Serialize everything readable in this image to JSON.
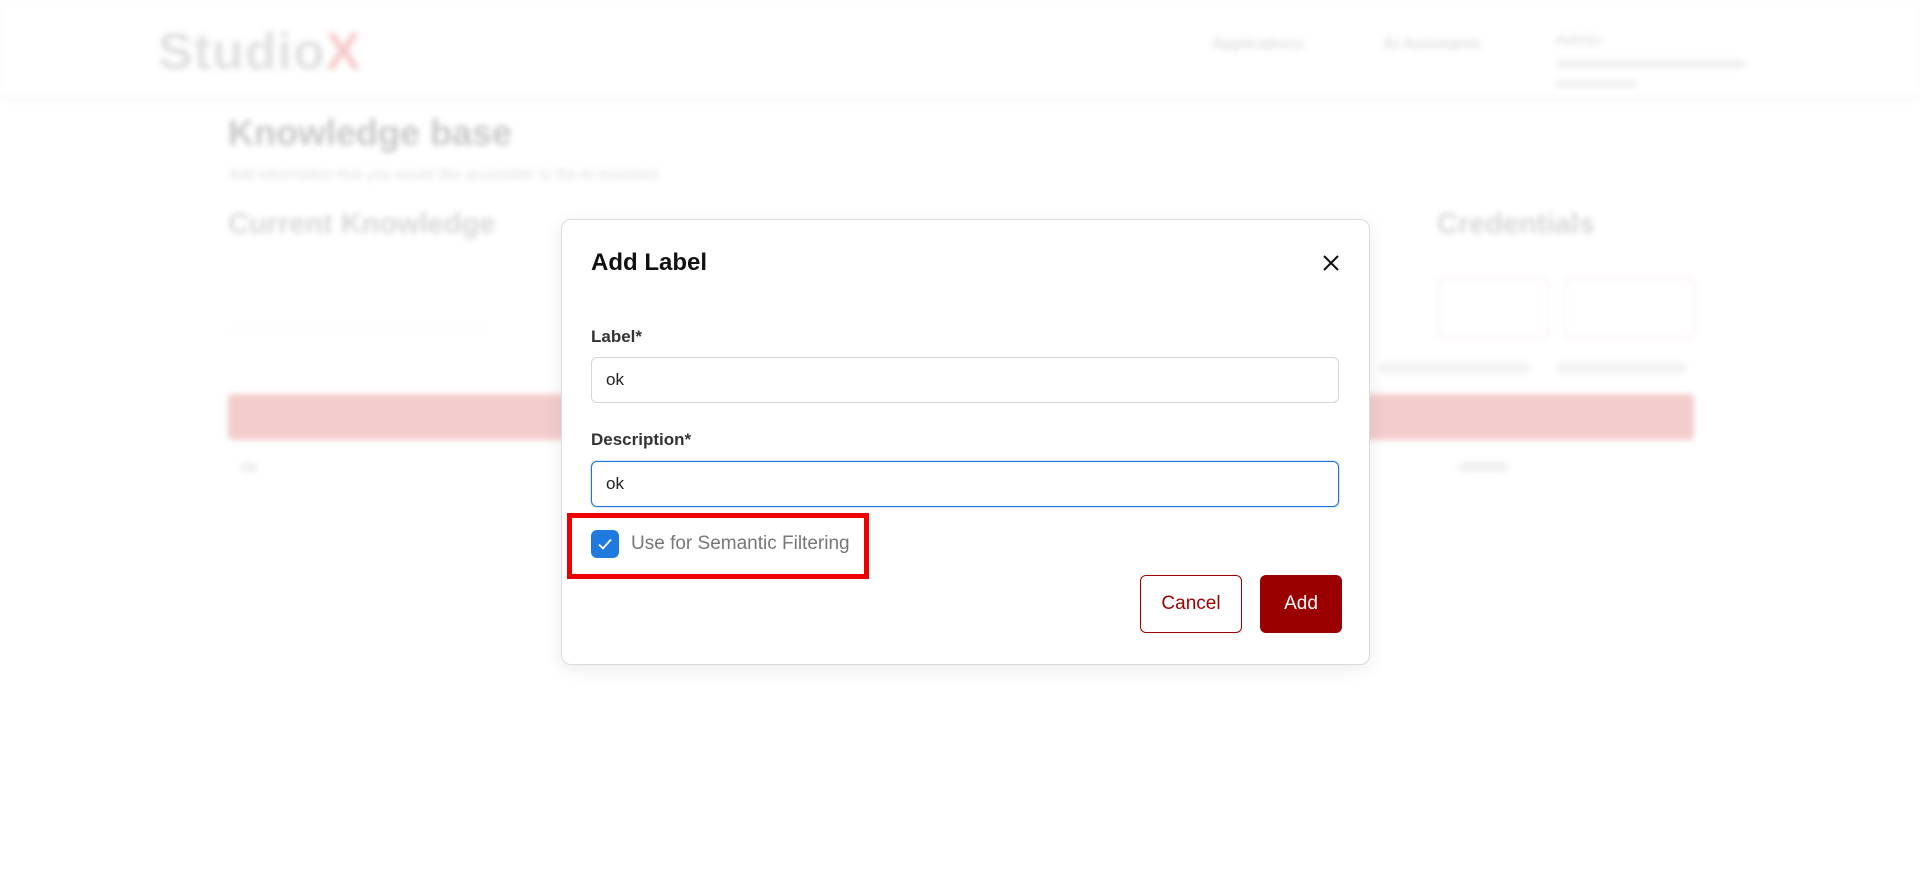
{
  "app": {
    "logo_text": "Studio",
    "logo_accent": "X"
  },
  "nav": {
    "items": [
      {
        "label": "Applications"
      },
      {
        "label": "AI Assistants"
      }
    ],
    "user_label": "Admin"
  },
  "page": {
    "title": "Knowledge base",
    "subtitle": "Add information that you would like accessible to the AI Assistant",
    "tabs": [
      {
        "label": "Current Knowledge"
      },
      {
        "label": "Credentials"
      }
    ]
  },
  "modal": {
    "title": "Add Label",
    "label_field": {
      "label": "Label*",
      "value": "ok"
    },
    "description_field": {
      "label": "Description*",
      "value": "ok"
    },
    "semantic_checkbox": {
      "label": "Use for Semantic Filtering",
      "checked": true
    },
    "cancel_label": "Cancel",
    "add_label": "Add"
  },
  "colors": {
    "brand": "#9a0000",
    "checkbox": "#1f7ae0",
    "focus_border": "#1e72d8",
    "highlight": "#ee0000"
  },
  "icons": {
    "close": "close-icon",
    "check": "checkmark-icon"
  }
}
